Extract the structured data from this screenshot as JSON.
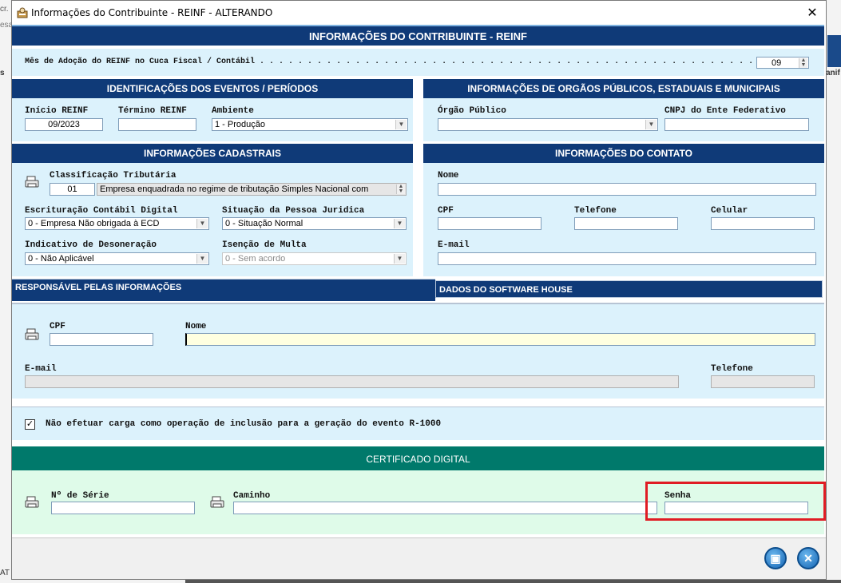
{
  "background": {
    "left_top_1": "cr.",
    "left_top_2": "esa",
    "left_mid": "s",
    "right_mid": "anif",
    "left_bottom": "AT"
  },
  "window": {
    "title": "Informações do Contribuinte  -  REINF  -  ALTERANDO",
    "close_glyph": "✕"
  },
  "main_header": "INFORMAÇÕES DO CONTRIBUINTE  -  REINF",
  "adoption": {
    "label": "Mês de Adoção do REINF no Cuca Fiscal / Contábil . . . . . . . . . . . . . . . . . . . . . . . . . . . . . . . . . . . . . . . . . . . . . . . . . . . . :",
    "value": "09"
  },
  "identificacoes": {
    "header": "IDENTIFICAÇÕES DOS EVENTOS / PERÍODOS",
    "inicio_label": "Início REINF",
    "inicio_value": "09/2023",
    "termino_label": "Término REINF",
    "termino_value": "",
    "ambiente_label": "Ambiente",
    "ambiente_value": "1 - Produção"
  },
  "orgaos": {
    "header": "INFORMAÇÕES DE ORGÃOS PÚBLICOS, ESTADUAIS E MUNICIPAIS",
    "orgao_label": "Órgão Público",
    "orgao_value": "",
    "cnpj_label": "CNPJ do Ente Federativo",
    "cnpj_value": ""
  },
  "cadastrais": {
    "header": "INFORMAÇÕES CADASTRAIS",
    "class_label": "Classificação Tributária",
    "class_code": "01",
    "class_desc": "Empresa enquadrada no regime de tributação Simples Nacional com",
    "escrit_label": "Escrituração Contábil Digital",
    "escrit_value": "0 - Empresa Não obrigada à ECD",
    "situacao_label": "Situação da Pessoa Juridica",
    "situacao_value": "0 - Situação Normal",
    "desoner_label": "Indicativo de Desoneração",
    "desoner_value": "0 - Não Aplicável",
    "isencao_label": "Isenção de Multa",
    "isencao_value": "0 - Sem acordo"
  },
  "contato": {
    "header": "INFORMAÇÕES DO CONTATO",
    "nome_label": "Nome",
    "nome_value": "",
    "cpf_label": "CPF",
    "cpf_value": "",
    "telefone_label": "Telefone",
    "telefone_value": "",
    "celular_label": "Celular",
    "celular_value": "",
    "email_label": "E-mail",
    "email_value": ""
  },
  "tabs": {
    "responsavel": "RESPONSÁVEL PELAS INFORMAÇÕES",
    "software": "DADOS DO SOFTWARE HOUSE"
  },
  "responsavel": {
    "cpf_label": "CPF",
    "cpf_value": "",
    "nome_label": "Nome",
    "nome_value": "",
    "email_label": "E-mail",
    "email_value": "",
    "telefone_label": "Telefone",
    "telefone_value": ""
  },
  "carga": {
    "checked": true,
    "check_glyph": "✓",
    "label": "Não efetuar carga como operação de inclusão para a geração do evento R-1000"
  },
  "certificado": {
    "header": "CERTIFICADO DIGITAL",
    "serie_label": "Nº de Série",
    "serie_value": "",
    "caminho_label": "Caminho",
    "caminho_value": "",
    "senha_label": "Senha",
    "senha_value": ""
  },
  "buttons": {
    "save_glyph": "▣",
    "close_glyph": "✕"
  },
  "colors": {
    "header_blue": "#0f3a78",
    "header_teal": "#00796b",
    "panel_blue": "#dcf2fc",
    "panel_green": "#dffbe9",
    "highlight": "#e01c24"
  }
}
